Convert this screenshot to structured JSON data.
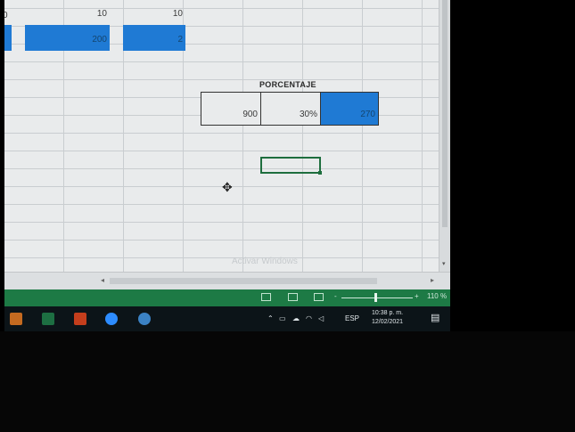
{
  "cells": {
    "row1_a": "10",
    "row1_b": "10",
    "row2_a": "200",
    "row2_b": "2",
    "label_porcentaje": "PORCENTAJE",
    "value_base": "900",
    "value_percent": "30%",
    "value_result": "270"
  },
  "watermark": "Activar Windows",
  "statusbar": {
    "zoom_minus": "-",
    "zoom_plus": "+",
    "zoom_level": "110 %"
  },
  "taskbar": {
    "tray_lang": "ESP",
    "clock_time": "10:38 p. m.",
    "clock_date": "12/02/2021"
  },
  "colors": {
    "excel_green": "#1d7a45",
    "cell_blue": "#1f7ad4",
    "taskbar": "#0c1418"
  }
}
